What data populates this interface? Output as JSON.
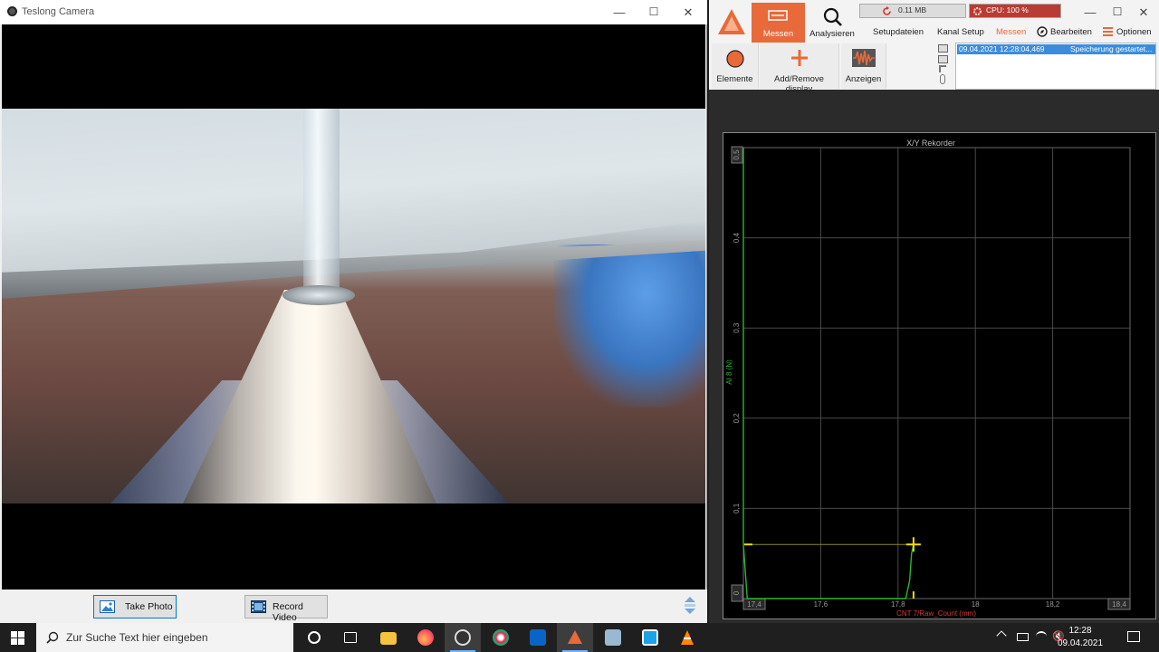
{
  "camera_window": {
    "title": "Teslong Camera",
    "take_photo_label": "Take Photo",
    "record_video_label": "Record Video"
  },
  "dewesoft": {
    "main_tabs": [
      "Messen",
      "Analysieren"
    ],
    "menu_items": [
      "Setupdateien",
      "Kanal Setup",
      "Messen",
      "Bearbeiten",
      "Optionen"
    ],
    "memory": "0.11 MB",
    "cpu": "CPU: 100 %",
    "toolbar": [
      "Elemente",
      "Add/Remove display",
      "Anzeigen"
    ],
    "log": {
      "time": "09.04.2021 12:28:04,469",
      "message": "Speicherung gestartet..."
    },
    "accent_color": "#e8693a"
  },
  "chart_data": {
    "type": "line",
    "title": "X/Y Rekorder",
    "xlabel": "CNT 7/Raw_Count (mm)",
    "ylabel": "AI 8 (N)",
    "xlim": [
      17.4,
      18.4
    ],
    "ylim": [
      0,
      0.5
    ],
    "xticks": [
      "17,4",
      "17,6",
      "17,8",
      "18",
      "18,2",
      "18,4"
    ],
    "yticks": [
      "0",
      "0,1",
      "0,2",
      "0,3",
      "0,4",
      "0,5"
    ],
    "grid": true,
    "series": [
      {
        "color": "#2db52d",
        "x": [
          17.4,
          17.4,
          17.41,
          17.6,
          17.8,
          17.82,
          17.83,
          17.835,
          17.84
        ],
        "y": [
          0.5,
          0.06,
          0.0,
          0.0,
          0.0,
          0.0,
          0.02,
          0.05,
          0.06
        ]
      }
    ],
    "cursor": {
      "x": 17.84,
      "y": 0.06,
      "color": "#f0e000"
    }
  },
  "taskbar": {
    "search_placeholder": "Zur Suche Text hier eingeben",
    "time": "12:28",
    "date": "09.04.2021"
  }
}
